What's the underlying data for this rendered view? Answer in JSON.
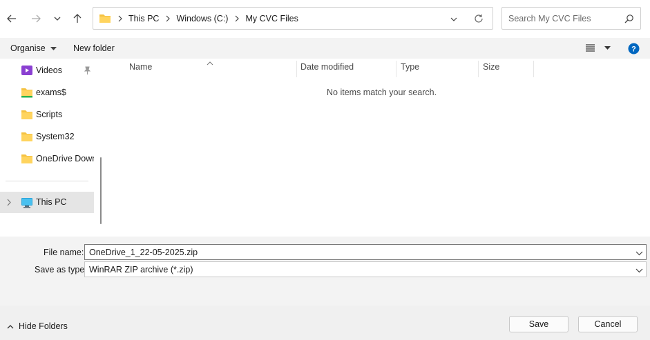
{
  "nav": {
    "back_icon": "arrow-left-icon",
    "forward_icon": "arrow-right-icon",
    "recent_icon": "chevron-down-icon",
    "up_icon": "arrow-up-icon",
    "breadcrumbs": [
      "This PC",
      "Windows (C:)",
      "My CVC Files"
    ],
    "refresh_icon": "refresh-icon",
    "search_placeholder": "Search My CVC Files"
  },
  "toolbar": {
    "organise": "Organise",
    "new_folder": "New folder"
  },
  "sidebar": {
    "items": [
      {
        "label": "Videos",
        "icon": "videos-folder-icon",
        "pinned": true
      },
      {
        "label": "exams$",
        "icon": "network-folder-icon"
      },
      {
        "label": "Scripts",
        "icon": "folder-icon"
      },
      {
        "label": "System32",
        "icon": "folder-icon"
      },
      {
        "label": "OneDrive Down",
        "icon": "folder-icon"
      }
    ],
    "this_pc": "This PC"
  },
  "columns": [
    "Name",
    "Date modified",
    "Type",
    "Size"
  ],
  "empty_message": "No items match your search.",
  "form": {
    "file_name_label": "File name:",
    "file_name_value": "OneDrive_1_22-05-2025.zip",
    "save_type_label": "Save as type:",
    "save_type_value": "WinRAR ZIP archive (*.zip)"
  },
  "footer": {
    "hide_folders": "Hide Folders",
    "save": "Save",
    "cancel": "Cancel"
  },
  "colors": {
    "folder": "#f5c242",
    "accent": "#0067c0",
    "selected_bg": "#e5e5e5"
  }
}
